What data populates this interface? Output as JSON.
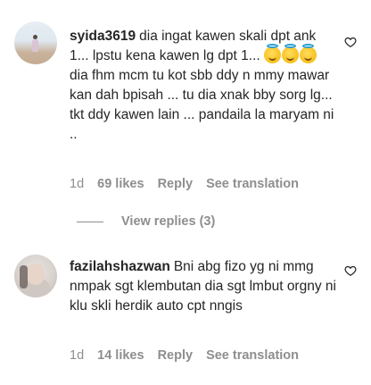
{
  "comments": [
    {
      "username": "syida3619",
      "text_parts": [
        "dia ingat kawen skali dpt ank 1... lpstu kena kawen lg dpt 1... ",
        " dia fhm mcm tu kot sbb ddy n mmy mawar kan dah bpisah ... tu dia xnak bby sorg lg... tkt ddy kawen lain ... pandaila la maryam ni .."
      ],
      "emoji": "smiling-face-with-halo",
      "time": "1d",
      "likes": "69 likes",
      "reply_label": "Reply",
      "translation_label": "See translation",
      "view_replies_label": "View replies (3)"
    },
    {
      "username": "fazilahshazwan",
      "text": "Bni abg fizo yg ni mmg nmpak sgt klembutan dia sgt lmbut orgny ni klu skli herdik auto cpt nngis",
      "time": "1d",
      "likes": "14 likes",
      "reply_label": "Reply",
      "translation_label": "See translation"
    }
  ],
  "icons": {
    "like": "heart-outline-icon"
  },
  "colors": {
    "text": "#262626",
    "secondary": "#8e8e8e",
    "background": "#ffffff"
  }
}
